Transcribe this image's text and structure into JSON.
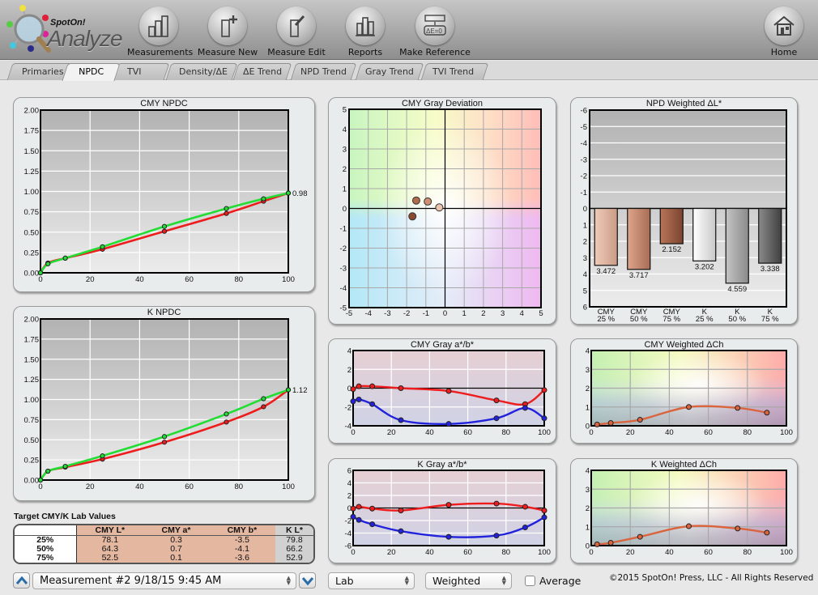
{
  "app": {
    "logo_brand": "SpotOn!",
    "logo_product": "Analyze"
  },
  "toolbar": {
    "buttons": [
      {
        "label": "Measurements",
        "icon": "bar-ruler-icon"
      },
      {
        "label": "Measure New",
        "icon": "ruler-plus-icon"
      },
      {
        "label": "Measure Edit",
        "icon": "ruler-pencil-icon"
      },
      {
        "label": "Reports",
        "icon": "bar-chart-icon"
      },
      {
        "label": "Make Reference",
        "icon": "delta-e-zero-icon"
      }
    ],
    "home": {
      "label": "Home",
      "icon": "home-icon"
    }
  },
  "tabs": [
    {
      "label": "Primaries",
      "active": false
    },
    {
      "label": "NPDC",
      "active": true
    },
    {
      "label": "TVI",
      "active": false
    },
    {
      "label": "Density/ΔE",
      "active": false
    },
    {
      "label": "ΔE Trend",
      "active": false
    },
    {
      "label": "NPD Trend",
      "active": false
    },
    {
      "label": "Gray Trend",
      "active": false
    },
    {
      "label": "TVI Trend",
      "active": false
    }
  ],
  "colors": {
    "measured_line": "#ee1c1c",
    "target_line": "#22dd33",
    "a_line": "#ee1c1c",
    "b_line": "#2222dd",
    "ch_line": "#d9643e"
  },
  "chart_data": [
    {
      "id": "cmy-npdc",
      "type": "line",
      "title": "CMY NPDC",
      "xlabel": "",
      "ylabel": "",
      "xlim": [
        0,
        100
      ],
      "ylim": [
        0,
        2
      ],
      "xticks": [
        "0",
        "20",
        "40",
        "60",
        "80",
        "100"
      ],
      "yticks": [
        "0.00",
        "0.25",
        "0.50",
        "0.75",
        "1.00",
        "1.25",
        "1.50",
        "1.75",
        "2.00"
      ],
      "end_label": "0.98",
      "x": [
        0,
        3,
        10,
        25,
        50,
        75,
        90,
        100
      ],
      "series": [
        {
          "name": "Measured",
          "color": "#ee1c1c",
          "values": [
            0.0,
            0.12,
            0.18,
            0.29,
            0.51,
            0.73,
            0.88,
            0.98
          ]
        },
        {
          "name": "Target",
          "color": "#22dd33",
          "values": [
            0.0,
            0.11,
            0.18,
            0.32,
            0.57,
            0.79,
            0.91,
            0.98
          ]
        }
      ]
    },
    {
      "id": "k-npdc",
      "type": "line",
      "title": "K NPDC",
      "xlim": [
        0,
        100
      ],
      "ylim": [
        0,
        2
      ],
      "xticks": [
        "0",
        "20",
        "40",
        "60",
        "80",
        "100"
      ],
      "yticks": [
        "0.00",
        "0.25",
        "0.50",
        "0.75",
        "1.00",
        "1.25",
        "1.50",
        "1.75",
        "2.00"
      ],
      "end_label": "1.12",
      "x": [
        0,
        3,
        10,
        25,
        50,
        75,
        90,
        100
      ],
      "series": [
        {
          "name": "Measured",
          "color": "#ee1c1c",
          "values": [
            0.0,
            0.11,
            0.16,
            0.26,
            0.47,
            0.72,
            0.91,
            1.12
          ]
        },
        {
          "name": "Target",
          "color": "#22dd33",
          "values": [
            0.0,
            0.11,
            0.17,
            0.3,
            0.54,
            0.82,
            1.01,
            1.12
          ]
        }
      ]
    },
    {
      "id": "cmy-gray-deviation",
      "type": "scatter",
      "title": "CMY Gray Deviation",
      "xlim": [
        -5,
        5
      ],
      "ylim": [
        -5,
        5
      ],
      "xticks": [
        "-5",
        "-4",
        "-3",
        "-2",
        "-1",
        "0",
        "1",
        "2",
        "3",
        "4",
        "5"
      ],
      "yticks": [
        "-5",
        "-4",
        "-3",
        "-2",
        "-1",
        "0",
        "1",
        "2",
        "3",
        "4",
        "5"
      ],
      "points": [
        {
          "x": -1.7,
          "y": -0.4,
          "color": "#8a4a30"
        },
        {
          "x": -1.5,
          "y": 0.4,
          "color": "#b06a4c"
        },
        {
          "x": -0.9,
          "y": 0.35,
          "color": "#cc9070"
        },
        {
          "x": -0.3,
          "y": 0.05,
          "color": "#ecc4ae"
        }
      ]
    },
    {
      "id": "npd-weighted-dl",
      "type": "bar",
      "title": "NPD Weighted ΔL*",
      "ylim": [
        6,
        -6
      ],
      "yticks": [
        "-6",
        "-5",
        "-4",
        "-3",
        "-2",
        "-1",
        "0",
        "1",
        "2",
        "3",
        "4",
        "5",
        "6"
      ],
      "categories": [
        "CMY 25%",
        "CMY 50%",
        "CMY 75%",
        "K 25%",
        "K 50%",
        "K 75%"
      ],
      "category_lines": [
        [
          "CMY",
          "25 %"
        ],
        [
          "CMY",
          "50 %"
        ],
        [
          "CMY",
          "75 %"
        ],
        [
          "K",
          "25 %"
        ],
        [
          "K",
          "50 %"
        ],
        [
          "K",
          "75 %"
        ]
      ],
      "values": [
        3.472,
        3.717,
        2.152,
        3.202,
        4.559,
        3.338
      ],
      "value_labels": [
        "3.472",
        "3.717",
        "2.152",
        "3.202",
        "4.559",
        "3.338"
      ],
      "bar_colors": [
        [
          "#f0cbb8",
          "#c99c86"
        ],
        [
          "#dea48c",
          "#a86d55"
        ],
        [
          "#b87659",
          "#7b4330"
        ],
        [
          "#ffffff",
          "#c9c9c9"
        ],
        [
          "#c4c4c4",
          "#8a8a8a"
        ],
        [
          "#8a8a8a",
          "#404040"
        ]
      ]
    },
    {
      "id": "cmy-gray-ab",
      "type": "line",
      "title": "CMY Gray a*/b*",
      "xlim": [
        0,
        100
      ],
      "ylim": [
        -4,
        4
      ],
      "xticks": [
        "0",
        "20",
        "40",
        "60",
        "80",
        "100"
      ],
      "yticks": [
        "-4",
        "-2",
        "0",
        "2",
        "4"
      ],
      "x": [
        0,
        3,
        10,
        25,
        50,
        75,
        90,
        100
      ],
      "series": [
        {
          "name": "a*",
          "color": "#ee1c1c",
          "values": [
            -0.1,
            0.2,
            0.2,
            0.0,
            -0.3,
            -1.3,
            -1.7,
            -0.2
          ]
        },
        {
          "name": "b*",
          "color": "#2222dd",
          "values": [
            -1.4,
            -1.2,
            -1.7,
            -3.4,
            -3.8,
            -3.2,
            -2.1,
            -3.2
          ]
        }
      ]
    },
    {
      "id": "k-gray-ab",
      "type": "line",
      "title": "K Gray a*/b*",
      "xlim": [
        0,
        100
      ],
      "ylim": [
        -6,
        6
      ],
      "xticks": [
        "0",
        "20",
        "40",
        "60",
        "80",
        "100"
      ],
      "yticks": [
        "-6",
        "-4",
        "-2",
        "0",
        "2",
        "4",
        "6"
      ],
      "x": [
        0,
        3,
        10,
        25,
        50,
        75,
        90,
        100
      ],
      "series": [
        {
          "name": "a*",
          "color": "#ee1c1c",
          "values": [
            -0.1,
            0.2,
            -0.1,
            -0.4,
            0.5,
            0.7,
            0.2,
            -0.4
          ]
        },
        {
          "name": "b*",
          "color": "#2222dd",
          "values": [
            -1.4,
            -1.9,
            -2.6,
            -3.7,
            -4.6,
            -4.4,
            -3.1,
            -1.5
          ]
        }
      ]
    },
    {
      "id": "cmy-weighted-dch",
      "type": "line",
      "title": "CMY Weighted ΔCh",
      "xlim": [
        0,
        100
      ],
      "ylim": [
        0,
        4
      ],
      "xticks": [
        "0",
        "20",
        "40",
        "60",
        "80",
        "100"
      ],
      "yticks": [
        "0",
        "1",
        "2",
        "3",
        "4"
      ],
      "x": [
        3,
        10,
        25,
        50,
        75,
        90
      ],
      "series": [
        {
          "name": "ΔCh",
          "color": "#d9643e",
          "values": [
            0.07,
            0.15,
            0.32,
            1.0,
            0.95,
            0.7
          ]
        }
      ]
    },
    {
      "id": "k-weighted-dch",
      "type": "line",
      "title": "K Weighted ΔCh",
      "xlim": [
        0,
        100
      ],
      "ylim": [
        0,
        4
      ],
      "xticks": [
        "0",
        "20",
        "40",
        "60",
        "80",
        "100"
      ],
      "yticks": [
        "0",
        "1",
        "2",
        "3",
        "4"
      ],
      "x": [
        3,
        10,
        25,
        50,
        75,
        90
      ],
      "series": [
        {
          "name": "ΔCh",
          "color": "#d9643e",
          "values": [
            0.07,
            0.15,
            0.47,
            1.03,
            0.91,
            0.69
          ]
        }
      ]
    }
  ],
  "lab_table": {
    "title": "Target CMY/K Lab Values",
    "headers": [
      "",
      "CMY L*",
      "CMY a*",
      "CMY b*",
      "K L*"
    ],
    "rows": [
      {
        "label": "25%",
        "cmy_l": "78.1",
        "cmy_a": "0.3",
        "cmy_b": "-3.5",
        "k_l": "79.8"
      },
      {
        "label": "50%",
        "cmy_l": "64.3",
        "cmy_a": "0.7",
        "cmy_b": "-4.1",
        "k_l": "66.2"
      },
      {
        "label": "75%",
        "cmy_l": "52.5",
        "cmy_a": "0.1",
        "cmy_b": "-3.6",
        "k_l": "52.9"
      }
    ]
  },
  "bottom": {
    "measurement_select": "Measurement #2 9/18/15 9:45 AM",
    "colorspace_select": "Lab",
    "mode_select": "Weighted",
    "average_label": "Average",
    "average_checked": false,
    "copyright": "©2015 SpotOn! Press, LLC - All Rights Reserved"
  }
}
